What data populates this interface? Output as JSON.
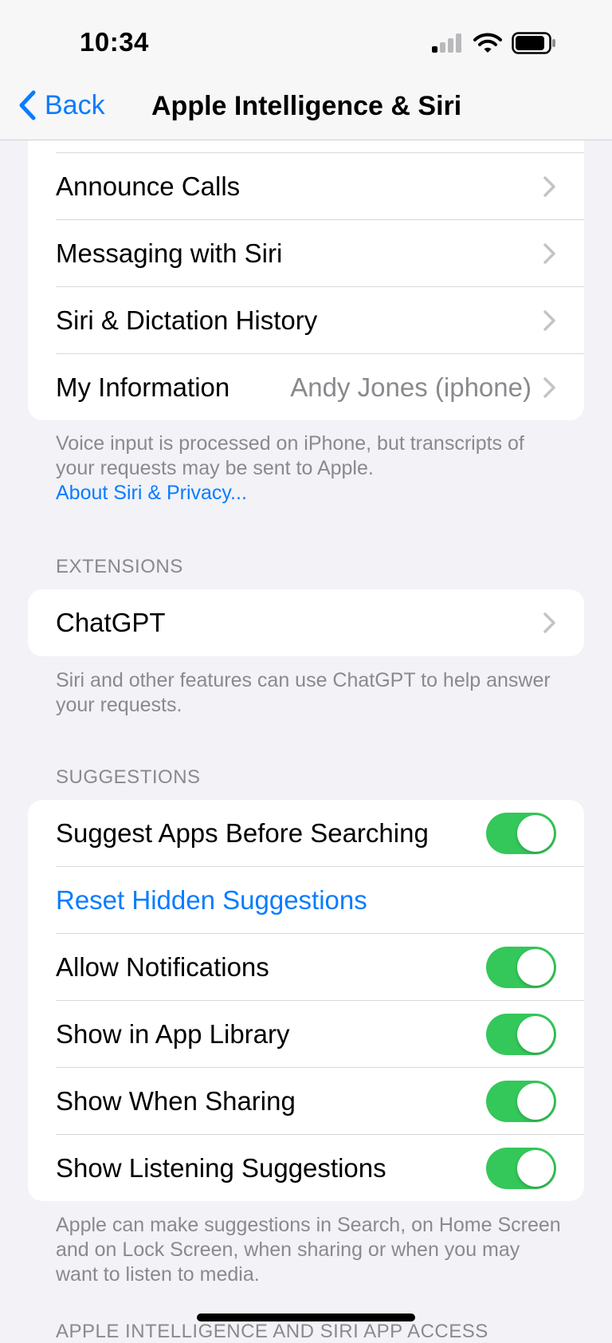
{
  "status_bar": {
    "time": "10:34"
  },
  "nav": {
    "back_label": "Back",
    "title": "Apple Intelligence & Siri"
  },
  "siri_section": {
    "rows": [
      {
        "label": "Announce Calls"
      },
      {
        "label": "Messaging with Siri"
      },
      {
        "label": "Siri & Dictation History"
      },
      {
        "label": "My Information",
        "value": "Andy Jones (iphone)"
      }
    ],
    "footnote": "Voice input is processed on iPhone, but transcripts of your requests may be sent to Apple.",
    "footnote_link": "About Siri & Privacy..."
  },
  "extensions_section": {
    "header": "EXTENSIONS",
    "rows": [
      {
        "label": "ChatGPT"
      }
    ],
    "footnote": "Siri and other features can use ChatGPT to help answer your requests."
  },
  "suggestions_section": {
    "header": "SUGGESTIONS",
    "rows": [
      {
        "label": "Suggest Apps Before Searching",
        "toggle": "on"
      },
      {
        "label": "Reset Hidden Suggestions"
      },
      {
        "label": "Allow Notifications",
        "toggle": "on"
      },
      {
        "label": "Show in App Library",
        "toggle": "on"
      },
      {
        "label": "Show When Sharing",
        "toggle": "on"
      },
      {
        "label": "Show Listening Suggestions",
        "toggle": "on"
      }
    ],
    "footnote": "Apple can make suggestions in Search, on Home Screen and on Lock Screen, when sharing or when you may want to listen to media."
  },
  "next_section": {
    "header": "APPLE INTELLIGENCE AND SIRI APP ACCESS"
  },
  "colors": {
    "accent": "#0a7cff",
    "toggle_on": "#34c759",
    "background": "#f2f2f7",
    "secondary_text": "#8a8a8e"
  },
  "icons": [
    "back-chevron-icon",
    "cellular-signal-icon",
    "wifi-icon",
    "battery-icon",
    "chevron-right-icon"
  ]
}
